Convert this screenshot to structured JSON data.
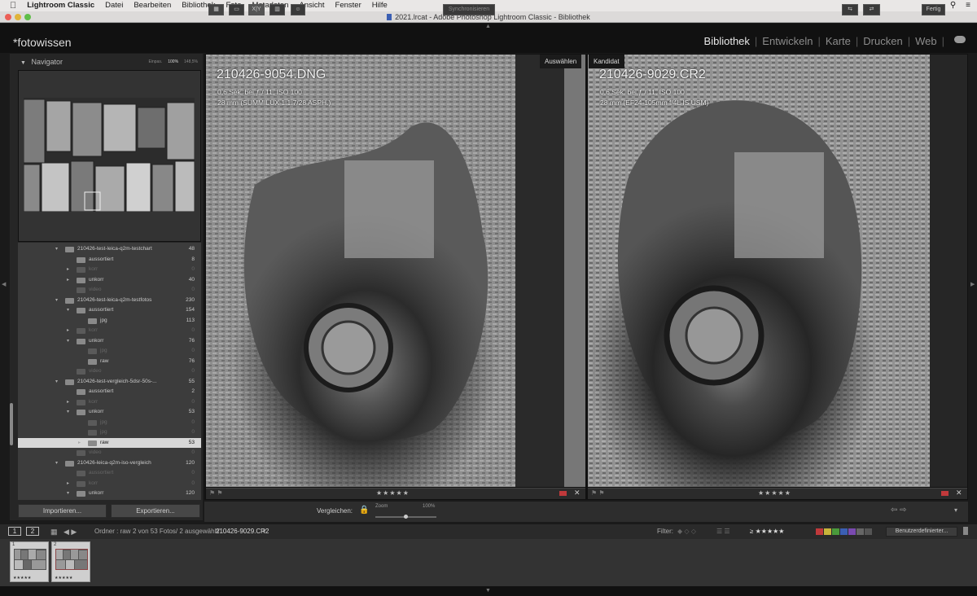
{
  "menubar": {
    "apple": "",
    "items": [
      "Lightroom Classic",
      "Datei",
      "Bearbeiten",
      "Bibliothek",
      "Foto",
      "Metadaten",
      "Ansicht",
      "Fenster",
      "Hilfe"
    ]
  },
  "window": {
    "title": "2021.lrcat - Adobe Photoshop Lightroom Classic - Bibliothek"
  },
  "identity_plate": "*fotowissen",
  "modules": [
    {
      "label": "Bibliothek",
      "active": true
    },
    {
      "label": "Entwickeln",
      "active": false
    },
    {
      "label": "Karte",
      "active": false
    },
    {
      "label": "Drucken",
      "active": false
    },
    {
      "label": "Web",
      "active": false
    }
  ],
  "navigator": {
    "title": "Navigator",
    "zoom_options": [
      "Einpas.",
      "100%",
      "148,5%"
    ],
    "zoom_selected": "100%"
  },
  "folders": [
    {
      "name": "210426-test-leica-q2m-testchart",
      "count": "48",
      "level": 0,
      "tri": "▾",
      "dim": false
    },
    {
      "name": "aussortiert",
      "count": "8",
      "level": 1,
      "tri": "",
      "dim": false
    },
    {
      "name": "korr",
      "count": "0",
      "level": 1,
      "tri": "▸",
      "dim": true
    },
    {
      "name": "unkorr",
      "count": "40",
      "level": 1,
      "tri": "▸",
      "dim": false
    },
    {
      "name": "video",
      "count": "0",
      "level": 1,
      "tri": "",
      "dim": true
    },
    {
      "name": "210426-test-leica-q2m-testfotos",
      "count": "230",
      "level": 0,
      "tri": "▾",
      "dim": false
    },
    {
      "name": "aussortiert",
      "count": "154",
      "level": 1,
      "tri": "▾",
      "dim": false
    },
    {
      "name": "jpg",
      "count": "113",
      "level": 2,
      "tri": "",
      "dim": false
    },
    {
      "name": "korr",
      "count": "0",
      "level": 1,
      "tri": "▸",
      "dim": true
    },
    {
      "name": "unkorr",
      "count": "76",
      "level": 1,
      "tri": "▾",
      "dim": false
    },
    {
      "name": "jpg",
      "count": "0",
      "level": 2,
      "tri": "",
      "dim": true
    },
    {
      "name": "raw",
      "count": "76",
      "level": 2,
      "tri": "",
      "dim": false
    },
    {
      "name": "video",
      "count": "0",
      "level": 1,
      "tri": "",
      "dim": true
    },
    {
      "name": "210426-test-vergleich-5dsr-50s-...",
      "count": "55",
      "level": 0,
      "tri": "▾",
      "dim": false
    },
    {
      "name": "aussortiert",
      "count": "2",
      "level": 1,
      "tri": "",
      "dim": false
    },
    {
      "name": "korr",
      "count": "0",
      "level": 1,
      "tri": "▸",
      "dim": true
    },
    {
      "name": "unkorr",
      "count": "53",
      "level": 1,
      "tri": "▾",
      "dim": false
    },
    {
      "name": "jpg",
      "count": "0",
      "level": 2,
      "tri": "",
      "dim": true
    },
    {
      "name": "jpg",
      "count": "0",
      "level": 2,
      "tri": "",
      "dim": true
    },
    {
      "name": "raw",
      "count": "53",
      "level": 2,
      "tri": "▸",
      "dim": false,
      "selected": true
    },
    {
      "name": "video",
      "count": "0",
      "level": 1,
      "tri": "",
      "dim": true
    },
    {
      "name": "210426-leica-q2m-iso-vergleich",
      "count": "120",
      "level": 0,
      "tri": "▾",
      "dim": false
    },
    {
      "name": "aussortiert",
      "count": "0",
      "level": 1,
      "tri": "",
      "dim": true
    },
    {
      "name": "korr",
      "count": "0",
      "level": 1,
      "tri": "▸",
      "dim": true
    },
    {
      "name": "unkorr",
      "count": "120",
      "level": 1,
      "tri": "▾",
      "dim": false
    }
  ],
  "buttons": {
    "import": "Importieren...",
    "export": "Exportieren..."
  },
  "select_photo": {
    "tag": "Auswählen",
    "filename": "210426-9054.DNG",
    "exposure": "0,6 Sek. bei ƒ / 11, ISO 100",
    "lens": "28 mm (SUMMILUX 1:1.7/28 ASPH.)",
    "rating": "★★★★★"
  },
  "candidate_photo": {
    "tag": "Kandidat",
    "filename": "210426-9029.CR2",
    "exposure": "0,6 Sek. bei ƒ / 11, ISO 100",
    "lens": "28 mm (EF24-105mm f/4L IS USM)",
    "rating": "★★★★★"
  },
  "toolbar": {
    "compare_label": "Vergleichen:",
    "zoom_label": "Zoom",
    "zoom_value": "100%",
    "sync_label": "Synchronisieren",
    "done_label": "Fertig",
    "xy_label": "X|Y"
  },
  "filmstrip": {
    "page1": "1",
    "page2": "2",
    "source": "Ordner : raw",
    "info": "2 von 53 Fotos/ 2 ausgewählt/",
    "current": "210426-9029.CR2",
    "filter_label": "Filter:",
    "rating_filter": "≥ ★★★★★",
    "custom_filter": "Benutzerdefinierter...",
    "color_labels": [
      "#c0393b",
      "#c7b43b",
      "#4a9a3b",
      "#3b5fb3",
      "#7a4ab0",
      "#666666",
      "#555555"
    ],
    "thumbs": [
      {
        "num": "1",
        "stars": "★★★★★"
      },
      {
        "num": "2",
        "stars": "★★★★★"
      }
    ]
  }
}
